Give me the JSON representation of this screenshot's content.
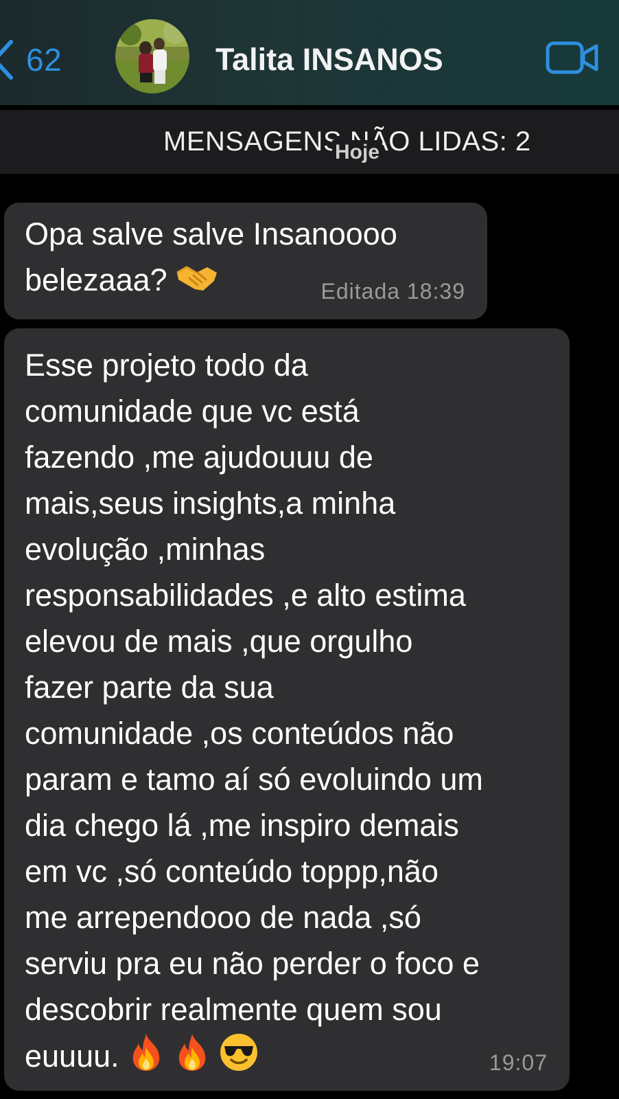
{
  "header": {
    "back_count": "62",
    "contact_name": "Talita INSANOS",
    "back_icon": "chevron-left-icon",
    "video_icon": "video-camera-icon",
    "accent_color": "#2e8fe0"
  },
  "unread_banner": {
    "text": "MENSAGENS NÃO LIDAS: 2",
    "date_label": "Hoje"
  },
  "messages": [
    {
      "text": "Opa salve salve Insanoooo\nbelezaaa?",
      "emojis": [
        "handshake-emoji"
      ],
      "meta": "Editada 18:39"
    },
    {
      "text": "Esse projeto todo da\ncomunidade que vc está\nfazendo ,me ajudouuu de\nmais,seus insights,a  minha\nevolução ,minhas\nresponsabilidades ,e alto estima\nelevou de mais ,que orgulho\nfazer parte  da sua\ncomunidade ,os conteúdos não\nparam e tamo aí só evoluindo um\ndia chego lá ,me inspiro demais\nem vc ,só conteúdo toppp,não\nme arrependooo de nada ,só\nserviu pra eu não perder o foco e\ndescobrir realmente quem sou\neuuuu.",
      "emojis": [
        "fire-emoji",
        "fire-emoji",
        "sunglasses-emoji"
      ],
      "meta": "19:07"
    }
  ]
}
